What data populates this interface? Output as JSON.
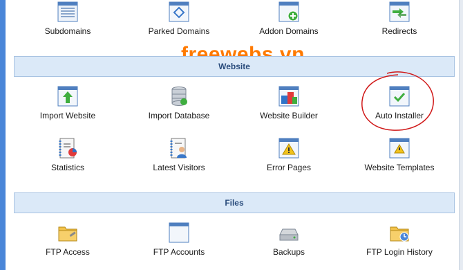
{
  "watermark": "freewebs.vn",
  "sections": [
    {
      "title": "Website"
    },
    {
      "title": "Files"
    }
  ],
  "rows": [
    [
      "Subdomains",
      "Parked Domains",
      "Addon Domains",
      "Redirects"
    ],
    [
      "Import Website",
      "Import Database",
      "Website Builder",
      "Auto Installer"
    ],
    [
      "Statistics",
      "Latest Visitors",
      "Error Pages",
      "Website Templates"
    ],
    [
      "FTP Access",
      "FTP Accounts",
      "Backups",
      "FTP Login History"
    ]
  ],
  "icons": {
    "subdomains": "list-window-icon",
    "parked_domains": "diamond-window-icon",
    "addon_domains": "add-window-icon",
    "redirects": "redirect-arrows-icon",
    "import_website": "upload-arrow-icon",
    "import_database": "database-icon",
    "website_builder": "blocks-icon",
    "auto_installer": "checkmark-window-icon",
    "statistics": "chart-notebook-icon",
    "latest_visitors": "visitor-notebook-icon",
    "error_pages": "warning-window-icon",
    "website_templates": "warning-page-icon",
    "ftp_access": "folder-wrench-icon",
    "ftp_accounts": "blank-window-icon",
    "backups": "drive-icon",
    "ftp_login_history": "folder-clock-icon"
  },
  "colors": {
    "accent": "#4a86d8",
    "header_bg": "#dbe9f8",
    "watermark": "#ff7a00",
    "annotation": "#d01818"
  }
}
